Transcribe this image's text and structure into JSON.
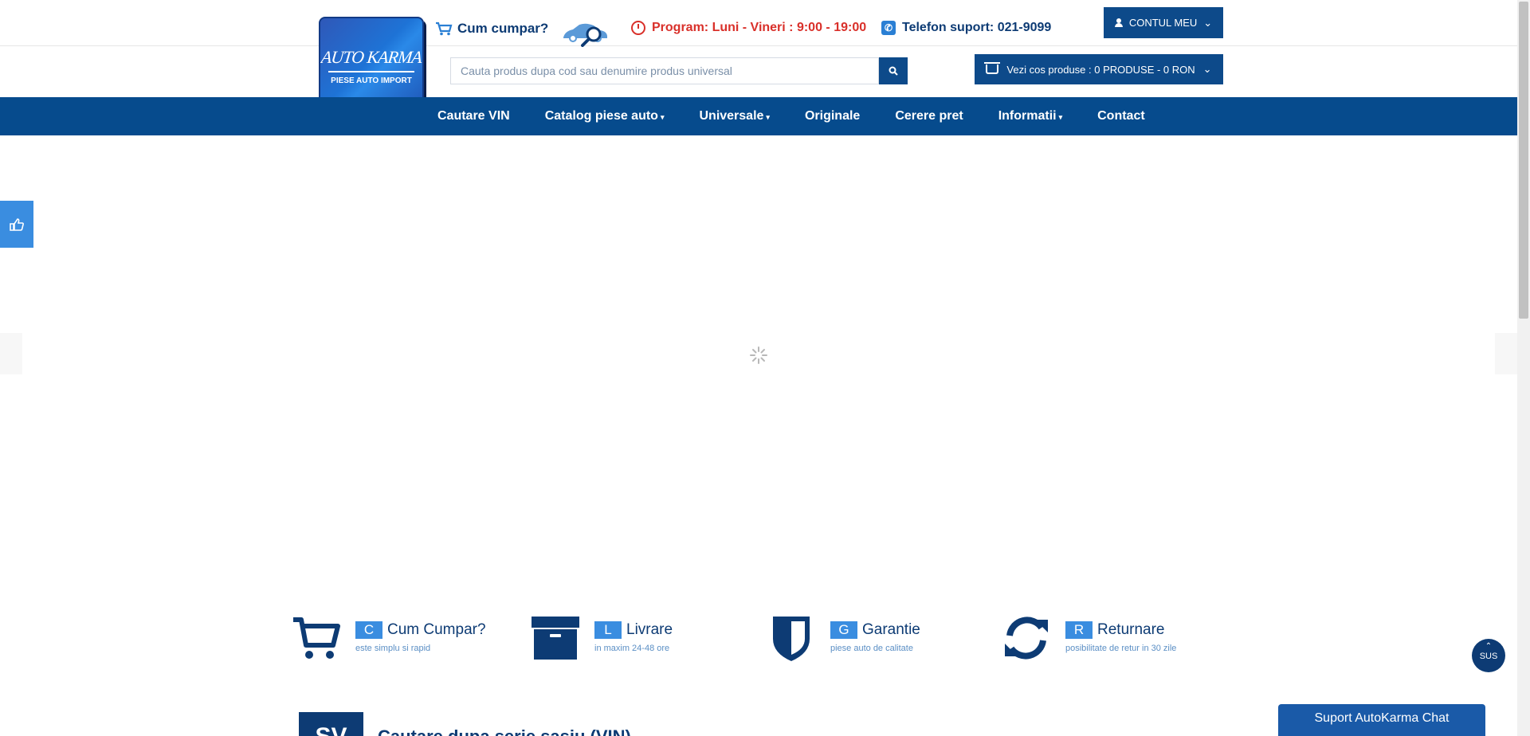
{
  "header": {
    "logo": {
      "line1": "AUTO KARMA",
      "line2": "PIESE AUTO IMPORT"
    },
    "how_to_buy": "Cum cumpar?",
    "program": "Program: Luni - Vineri : 9:00 - 19:00",
    "phone": "Telefon suport: 021-9099",
    "account_label": "CONTUL MEU",
    "search_placeholder": "Cauta produs dupa cod sau denumire produs universal",
    "cart_label": "Vezi cos produse :  0  PRODUSE  -  0 RON"
  },
  "nav": {
    "items": [
      {
        "label": "Cautare VIN",
        "dropdown": false
      },
      {
        "label": "Catalog piese auto",
        "dropdown": true
      },
      {
        "label": "Universale",
        "dropdown": true
      },
      {
        "label": "Originale",
        "dropdown": false
      },
      {
        "label": "Cerere pret",
        "dropdown": false
      },
      {
        "label": "Informatii",
        "dropdown": true
      },
      {
        "label": "Contact",
        "dropdown": false
      }
    ]
  },
  "features": [
    {
      "letter": "C",
      "title": "Cum Cumpar?",
      "subtitle": "este simplu si rapid",
      "icon": "cart-icon"
    },
    {
      "letter": "L",
      "title": "Livrare",
      "subtitle": "in maxim 24-48 ore",
      "icon": "box-icon"
    },
    {
      "letter": "G",
      "title": "Garantie",
      "subtitle": "piese auto de calitate",
      "icon": "shield-icon"
    },
    {
      "letter": "R",
      "title": "Returnare",
      "subtitle": "posibilitate de retur in 30 zile",
      "icon": "refresh-icon"
    }
  ],
  "back_to_top": "SUS",
  "chat_label": "Suport AutoKarma Chat",
  "vin_section": {
    "badge": "SV",
    "title": "Cautare dupa serie sasiu (VIN)"
  },
  "colors": {
    "primary": "#064b8d",
    "accent": "#3a8de0",
    "alert": "#d9302a"
  }
}
